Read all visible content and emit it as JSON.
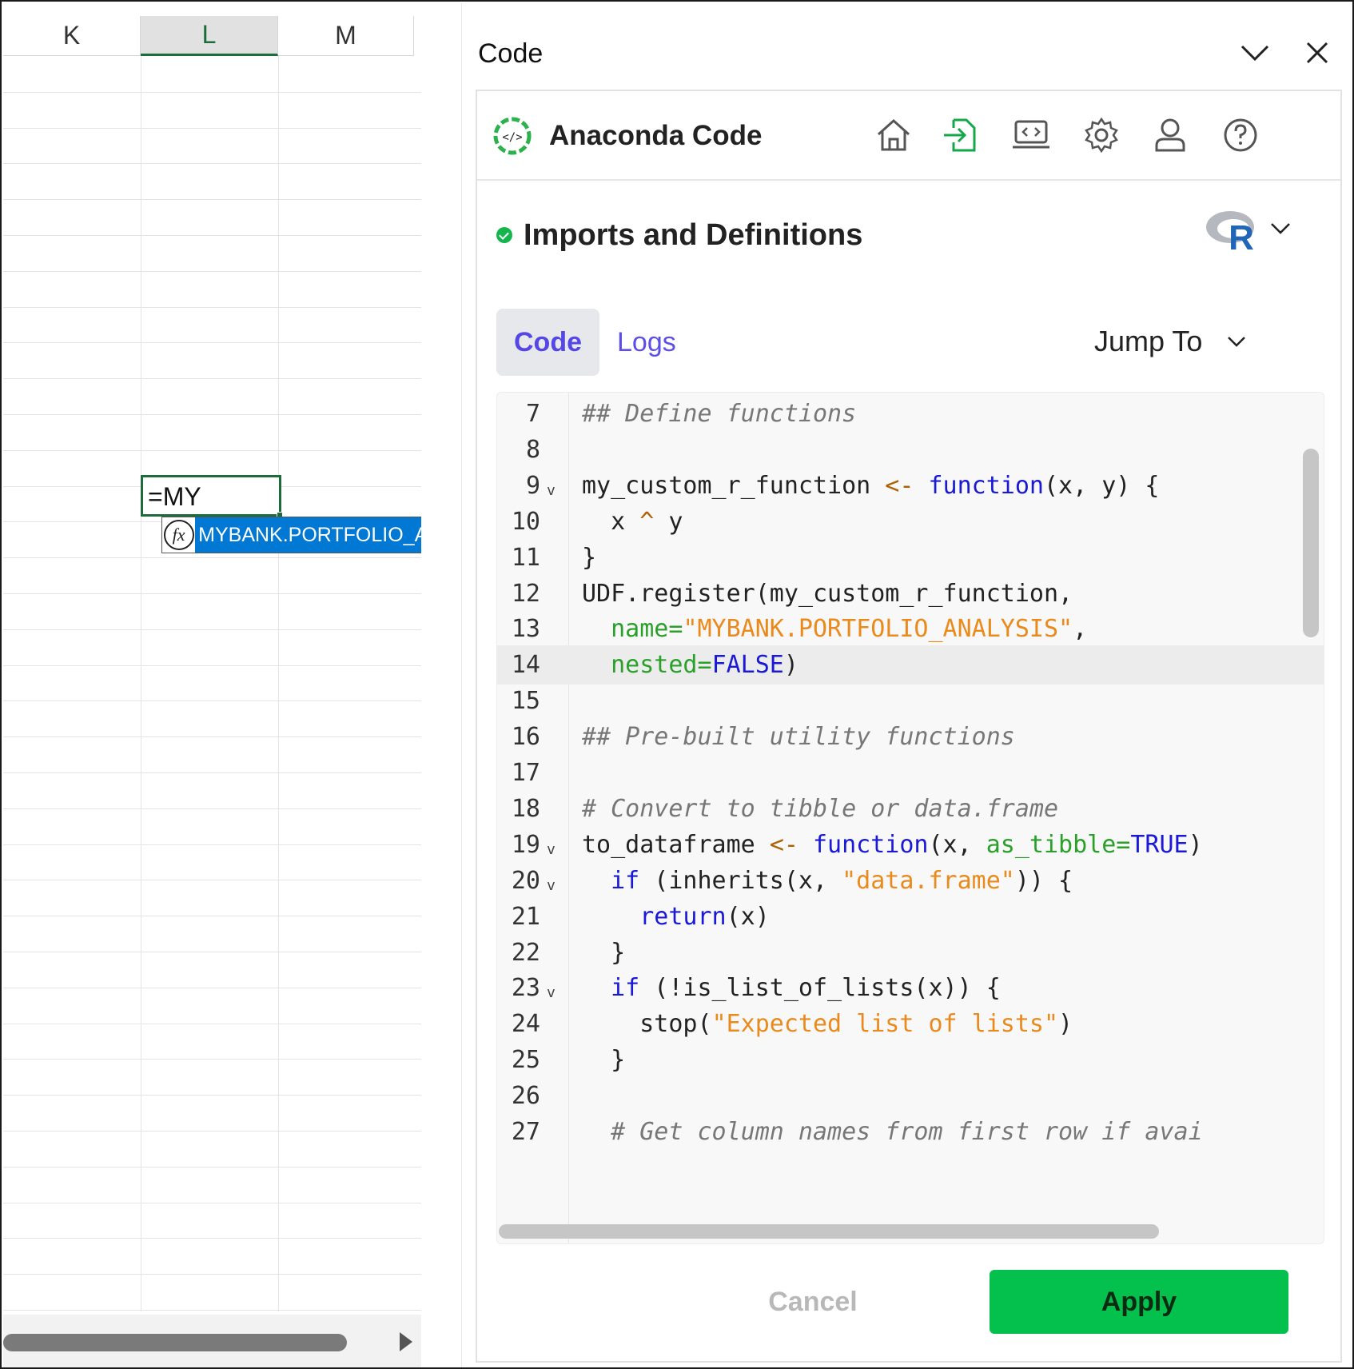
{
  "sheet": {
    "columns": [
      "K",
      "L",
      "M"
    ],
    "selected_column": "L",
    "active_cell_value": "=MY",
    "autocomplete": {
      "icon": "fx-function-icon",
      "suggestion": "MYBANK.PORTFOLIO_ANALYSIS"
    }
  },
  "pane": {
    "title": "Code",
    "brand": "Anaconda Code",
    "toolbar_icons": [
      "home-icon",
      "import-icon",
      "code-environment-icon",
      "settings-icon",
      "user-icon",
      "help-icon"
    ],
    "section": {
      "title": "Imports and Definitions",
      "status": "ok",
      "language_icon": "r-language-icon"
    },
    "tabs": [
      {
        "label": "Code",
        "active": true
      },
      {
        "label": "Logs",
        "active": false
      }
    ],
    "jump_to": "Jump To",
    "highlighted_line": 14,
    "code_lines": [
      {
        "n": "7",
        "fold": "",
        "text": "## Define functions"
      },
      {
        "n": "8",
        "fold": "",
        "text": ""
      },
      {
        "n": "9",
        "fold": "v",
        "text": "my_custom_r_function <- function(x, y) {"
      },
      {
        "n": "10",
        "fold": "",
        "text": "  x ^ y"
      },
      {
        "n": "11",
        "fold": "",
        "text": "}"
      },
      {
        "n": "12",
        "fold": "",
        "text": "UDF.register(my_custom_r_function,"
      },
      {
        "n": "13",
        "fold": "",
        "text": "  name=\"MYBANK.PORTFOLIO_ANALYSIS\","
      },
      {
        "n": "14",
        "fold": "",
        "text": "  nested=FALSE)"
      },
      {
        "n": "15",
        "fold": "",
        "text": ""
      },
      {
        "n": "16",
        "fold": "",
        "text": "## Pre-built utility functions"
      },
      {
        "n": "17",
        "fold": "",
        "text": ""
      },
      {
        "n": "18",
        "fold": "",
        "text": "# Convert to tibble or data.frame"
      },
      {
        "n": "19",
        "fold": "v",
        "text": "to_dataframe <- function(x, as_tibble=TRUE)"
      },
      {
        "n": "20",
        "fold": "v",
        "text": "  if (inherits(x, \"data.frame\")) {"
      },
      {
        "n": "21",
        "fold": "",
        "text": "    return(x)"
      },
      {
        "n": "22",
        "fold": "",
        "text": "  }"
      },
      {
        "n": "23",
        "fold": "v",
        "text": "  if (!is_list_of_lists(x)) {"
      },
      {
        "n": "24",
        "fold": "",
        "text": "    stop(\"Expected list of lists\")"
      },
      {
        "n": "25",
        "fold": "",
        "text": "  }"
      },
      {
        "n": "26",
        "fold": "",
        "text": ""
      },
      {
        "n": "27",
        "fold": "",
        "text": "  # Get column names from first row if avai"
      }
    ],
    "buttons": {
      "cancel": "Cancel",
      "apply": "Apply"
    },
    "colors": {
      "apply_green": "#04c04d",
      "tab_purple": "#5546e6",
      "excel_green": "#1d6b3a",
      "autocomplete_blue": "#0078d4"
    }
  }
}
